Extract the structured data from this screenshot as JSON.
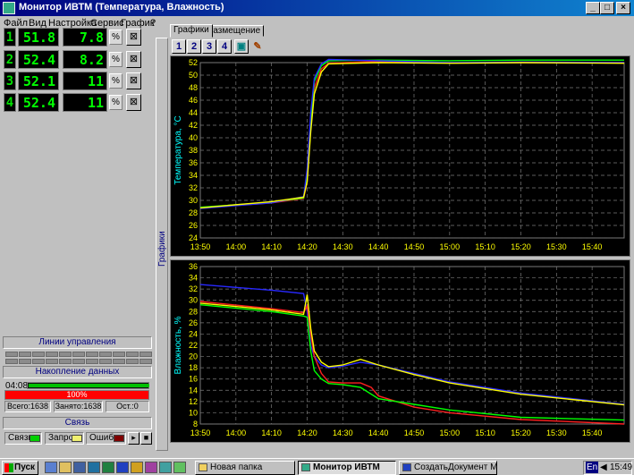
{
  "window": {
    "title": "Монитор ИВТМ (Температура, Влажность)"
  },
  "menu": [
    "Файл",
    "Вид",
    "Настройка",
    "Сервис",
    "График",
    "?"
  ],
  "channels": [
    {
      "num": "1",
      "temp": "51.8",
      "hum": "7.8",
      "unit": "%"
    },
    {
      "num": "2",
      "temp": "52.4",
      "hum": "8.2",
      "unit": "%"
    },
    {
      "num": "3",
      "temp": "52.1",
      "hum": "11",
      "unit": "%"
    },
    {
      "num": "4",
      "temp": "52.4",
      "hum": "11",
      "unit": "%"
    }
  ],
  "control_lines": {
    "title": "Линии управления"
  },
  "accumulation": {
    "title": "Накопление данных",
    "time": "04:08",
    "progress_pct": 100,
    "progress_label": "100%",
    "total": "Всего:1638",
    "occupied": "Занято:1638",
    "remaining": "Ост.:0"
  },
  "connection": {
    "title": "Связь",
    "link": "Связь",
    "request": "Запрос",
    "error": "Ошибка"
  },
  "side_tab": "Графики",
  "tabs": [
    "Графики",
    "Размещение"
  ],
  "toolbar": [
    "1",
    "2",
    "3",
    "4"
  ],
  "colors": {
    "ch1": "#ff2020",
    "ch2": "#00ff00",
    "ch3": "#2828ff",
    "ch4": "#ffff00",
    "grid": "#7a7a7a",
    "tick": "#ffff00",
    "axis_title": "#00ffff"
  },
  "chart_data": [
    {
      "type": "line",
      "ylabel": "Температура, °С",
      "ylim": [
        24,
        52
      ],
      "yticks": [
        24,
        26,
        28,
        30,
        32,
        34,
        36,
        38,
        40,
        42,
        44,
        46,
        48,
        50,
        52
      ],
      "xticks": [
        "13:50",
        "14:00",
        "14:10",
        "14:20",
        "14:30",
        "14:40",
        "14:50",
        "15:00",
        "15:10",
        "15:20",
        "15:30",
        "15:40"
      ],
      "xlim_minutes": [
        830,
        949
      ],
      "series": [
        {
          "color": "#ff2020",
          "x": [
            830,
            850,
            859,
            860,
            861,
            862,
            864,
            866,
            880,
            900,
            920,
            949
          ],
          "y": [
            28.8,
            29.6,
            30.3,
            33,
            42,
            48,
            51,
            51.9,
            52.2,
            52.0,
            52.0,
            52.0
          ]
        },
        {
          "color": "#00ff00",
          "x": [
            830,
            850,
            859,
            860,
            861,
            862,
            864,
            866,
            880,
            900,
            920,
            949
          ],
          "y": [
            28.9,
            29.7,
            30.4,
            34,
            43,
            49,
            51.5,
            52.3,
            52.4,
            52.3,
            52.4,
            52.4
          ]
        },
        {
          "color": "#2828ff",
          "x": [
            830,
            850,
            859,
            860,
            861,
            862,
            864,
            866,
            880,
            900,
            920,
            949
          ],
          "y": [
            28.7,
            29.6,
            30.6,
            35,
            44,
            49.5,
            51.8,
            52.5,
            52.3,
            52.0,
            52.1,
            52.0
          ]
        },
        {
          "color": "#ffff00",
          "x": [
            830,
            850,
            859,
            860,
            861,
            862,
            864,
            866,
            880,
            900,
            920,
            949
          ],
          "y": [
            28.8,
            29.8,
            30.5,
            33,
            41,
            47,
            50.5,
            51.8,
            52.0,
            51.9,
            52.0,
            51.9
          ]
        }
      ]
    },
    {
      "type": "line",
      "ylabel": "Влажность, %",
      "ylim": [
        8,
        36
      ],
      "yticks": [
        8,
        10,
        12,
        14,
        16,
        18,
        20,
        22,
        24,
        26,
        28,
        30,
        32,
        34,
        36
      ],
      "xticks": [
        "13:50",
        "14:00",
        "14:10",
        "14:20",
        "14:30",
        "14:40",
        "14:50",
        "15:00",
        "15:10",
        "15:20",
        "15:30",
        "15:40"
      ],
      "xlim_minutes": [
        830,
        949
      ],
      "series": [
        {
          "color": "#2828ff",
          "x": [
            830,
            840,
            850,
            859,
            860,
            861,
            862,
            864,
            866,
            870,
            875,
            880,
            890,
            900,
            920,
            949
          ],
          "y": [
            32.8,
            32.3,
            31.8,
            31.2,
            28,
            22,
            20,
            18.5,
            18,
            18.3,
            19,
            18.5,
            17,
            15.5,
            13.5,
            11.5
          ]
        },
        {
          "color": "#ff2020",
          "x": [
            830,
            850,
            859,
            860,
            861,
            862,
            864,
            866,
            870,
            875,
            878,
            880,
            890,
            900,
            920,
            949
          ],
          "y": [
            29.8,
            28.5,
            27.8,
            29,
            24,
            20,
            17,
            15.5,
            15.3,
            15.3,
            14.5,
            13,
            11,
            10,
            8.8,
            8.0
          ]
        },
        {
          "color": "#ffff00",
          "x": [
            830,
            850,
            859,
            860,
            861,
            862,
            864,
            866,
            870,
            875,
            880,
            890,
            900,
            920,
            949
          ],
          "y": [
            29.5,
            28.3,
            27.5,
            31,
            25,
            21,
            19,
            18.2,
            18.5,
            19.5,
            18.5,
            16.8,
            15.3,
            13.3,
            11.4
          ]
        },
        {
          "color": "#00ff00",
          "x": [
            830,
            850,
            859,
            860,
            861,
            862,
            864,
            866,
            870,
            875,
            880,
            890,
            900,
            920,
            949
          ],
          "y": [
            29.2,
            28.0,
            27.2,
            27,
            21,
            17.5,
            16,
            15.2,
            15,
            14.5,
            12.5,
            11.5,
            10.5,
            9.2,
            8.7
          ]
        }
      ]
    }
  ],
  "taskbar": {
    "start": "Пуск",
    "tasks": [
      "Новая папка",
      "Монитор ИВТМ",
      "СоздатьДокумент Micros..."
    ],
    "lang": "En",
    "clock": "15:49"
  }
}
